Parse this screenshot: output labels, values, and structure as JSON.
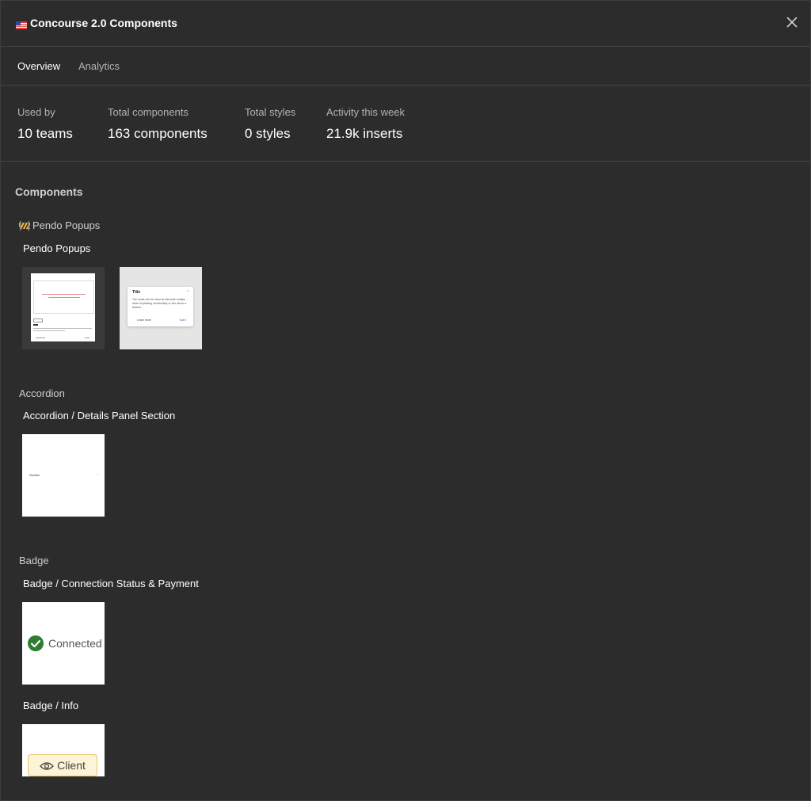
{
  "window": {
    "title": "Concourse 2.0 Components",
    "flag_icon": "flag-icon",
    "close_icon": "close-icon"
  },
  "tabs": [
    {
      "label": "Overview",
      "active": true
    },
    {
      "label": "Analytics",
      "active": false
    }
  ],
  "stats": [
    {
      "label": "Used by",
      "value": "10 teams"
    },
    {
      "label": "Total components",
      "value": "163 components"
    },
    {
      "label": "Total styles",
      "value": "0 styles"
    },
    {
      "label": "Activity this week",
      "value": "21.9k inserts"
    }
  ],
  "components": {
    "heading": "Components",
    "groups": [
      {
        "name": "Pendo Popups",
        "icon": "construction-icon",
        "items": [
          {
            "label": "Pendo Popups"
          }
        ]
      },
      {
        "name": "Accordion",
        "items": [
          {
            "label": "Accordion / Details Panel Section"
          }
        ]
      },
      {
        "name": "Badge",
        "items": [
          {
            "label": "Badge / Connection Status & Payment",
            "preview_text": "Connected"
          },
          {
            "label": "Badge / Info",
            "preview_text": "Client"
          }
        ]
      }
    ]
  },
  "previews": {
    "popup_title": "Title",
    "popup_body": "The cards can be used as alternate tooltips when explaining functionality or info about a feature.",
    "popup_learn": "Learn more",
    "popup_gotit": "Got it",
    "accordion_label": "Section"
  },
  "colors": {
    "background": "#2c2c2c",
    "border": "#444444",
    "success": "#2e7d32",
    "info_badge_bg": "#fdf3d6",
    "info_badge_border": "#e8c46a"
  }
}
